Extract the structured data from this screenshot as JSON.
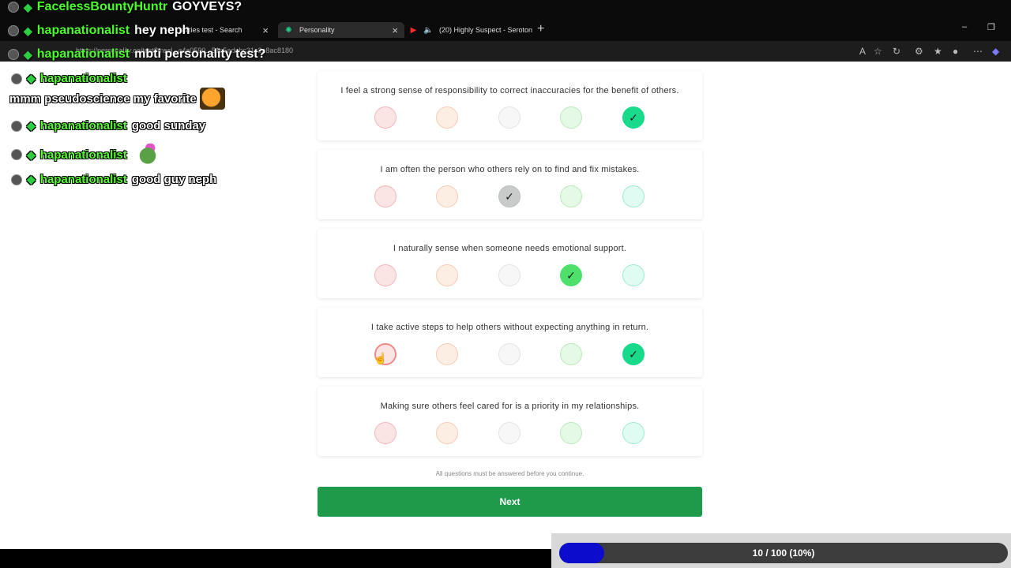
{
  "browser": {
    "tabs": [
      {
        "label": "alities test - Search",
        "close": "×"
      },
      {
        "label": "Personality",
        "close": "×"
      },
      {
        "label": "(20) Highly Suspect - Seroton",
        "close": "×"
      }
    ],
    "new_tab": "+",
    "url": "https://personality.co/test?mscl...c4a0590...51c5adabc31c2a8ac8180",
    "window_controls": [
      "–",
      "❐"
    ]
  },
  "chat": {
    "top_lines": [
      {
        "user": "FacelessBountyHuntr",
        "message": "GOYVEYS?"
      },
      {
        "user": "hapanationalist",
        "message": "hey neph"
      },
      {
        "user": "hapanationalist",
        "message": "mbti personality test?"
      }
    ],
    "lines": [
      {
        "user": "hapanationalist",
        "message": ""
      },
      {
        "user": "",
        "message": "mmm pseudoscience my favorite"
      },
      {
        "user": "hapanationalist",
        "message": "good sunday"
      },
      {
        "user": "hapanationalist",
        "message": ""
      },
      {
        "user": "hapanationalist",
        "message": "good guy neph"
      }
    ]
  },
  "questions": [
    {
      "text": "I feel a strong sense of responsibility to correct inaccuracies for the benefit of others.",
      "selected": 5
    },
    {
      "text": "I am often the person who others rely on to find and fix mistakes.",
      "selected": 3
    },
    {
      "text": "I naturally sense when someone needs emotional support.",
      "selected": 4
    },
    {
      "text": "I take active steps to help others without expecting anything in return.",
      "selected": 5
    },
    {
      "text": "Making sure others feel cared for is a priority in my relationships.",
      "selected": 0
    }
  ],
  "check_glyph": "✓",
  "note": "All questions must be answered before you continue.",
  "next_label": "Next",
  "progress": {
    "text": "10 / 100 (10%)",
    "fraction": 0.1
  }
}
